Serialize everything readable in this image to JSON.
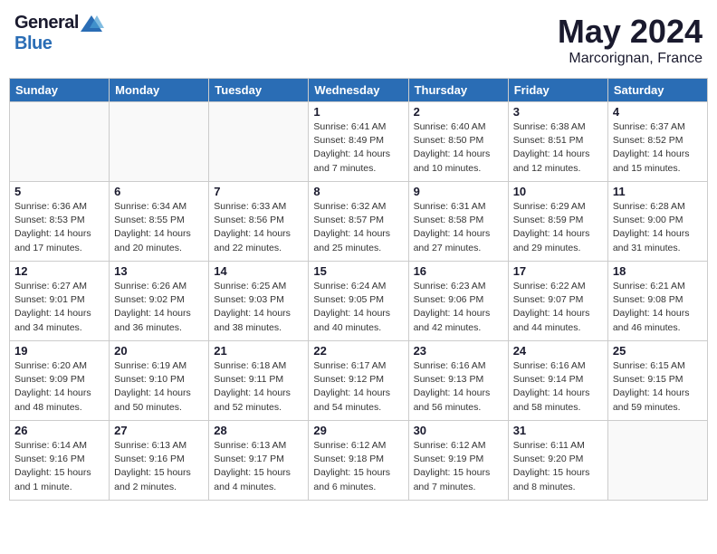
{
  "header": {
    "logo_general": "General",
    "logo_blue": "Blue",
    "title": "May 2024",
    "location": "Marcorignan, France"
  },
  "weekdays": [
    "Sunday",
    "Monday",
    "Tuesday",
    "Wednesday",
    "Thursday",
    "Friday",
    "Saturday"
  ],
  "weeks": [
    [
      {
        "day": "",
        "info": ""
      },
      {
        "day": "",
        "info": ""
      },
      {
        "day": "",
        "info": ""
      },
      {
        "day": "1",
        "info": "Sunrise: 6:41 AM\nSunset: 8:49 PM\nDaylight: 14 hours\nand 7 minutes."
      },
      {
        "day": "2",
        "info": "Sunrise: 6:40 AM\nSunset: 8:50 PM\nDaylight: 14 hours\nand 10 minutes."
      },
      {
        "day": "3",
        "info": "Sunrise: 6:38 AM\nSunset: 8:51 PM\nDaylight: 14 hours\nand 12 minutes."
      },
      {
        "day": "4",
        "info": "Sunrise: 6:37 AM\nSunset: 8:52 PM\nDaylight: 14 hours\nand 15 minutes."
      }
    ],
    [
      {
        "day": "5",
        "info": "Sunrise: 6:36 AM\nSunset: 8:53 PM\nDaylight: 14 hours\nand 17 minutes."
      },
      {
        "day": "6",
        "info": "Sunrise: 6:34 AM\nSunset: 8:55 PM\nDaylight: 14 hours\nand 20 minutes."
      },
      {
        "day": "7",
        "info": "Sunrise: 6:33 AM\nSunset: 8:56 PM\nDaylight: 14 hours\nand 22 minutes."
      },
      {
        "day": "8",
        "info": "Sunrise: 6:32 AM\nSunset: 8:57 PM\nDaylight: 14 hours\nand 25 minutes."
      },
      {
        "day": "9",
        "info": "Sunrise: 6:31 AM\nSunset: 8:58 PM\nDaylight: 14 hours\nand 27 minutes."
      },
      {
        "day": "10",
        "info": "Sunrise: 6:29 AM\nSunset: 8:59 PM\nDaylight: 14 hours\nand 29 minutes."
      },
      {
        "day": "11",
        "info": "Sunrise: 6:28 AM\nSunset: 9:00 PM\nDaylight: 14 hours\nand 31 minutes."
      }
    ],
    [
      {
        "day": "12",
        "info": "Sunrise: 6:27 AM\nSunset: 9:01 PM\nDaylight: 14 hours\nand 34 minutes."
      },
      {
        "day": "13",
        "info": "Sunrise: 6:26 AM\nSunset: 9:02 PM\nDaylight: 14 hours\nand 36 minutes."
      },
      {
        "day": "14",
        "info": "Sunrise: 6:25 AM\nSunset: 9:03 PM\nDaylight: 14 hours\nand 38 minutes."
      },
      {
        "day": "15",
        "info": "Sunrise: 6:24 AM\nSunset: 9:05 PM\nDaylight: 14 hours\nand 40 minutes."
      },
      {
        "day": "16",
        "info": "Sunrise: 6:23 AM\nSunset: 9:06 PM\nDaylight: 14 hours\nand 42 minutes."
      },
      {
        "day": "17",
        "info": "Sunrise: 6:22 AM\nSunset: 9:07 PM\nDaylight: 14 hours\nand 44 minutes."
      },
      {
        "day": "18",
        "info": "Sunrise: 6:21 AM\nSunset: 9:08 PM\nDaylight: 14 hours\nand 46 minutes."
      }
    ],
    [
      {
        "day": "19",
        "info": "Sunrise: 6:20 AM\nSunset: 9:09 PM\nDaylight: 14 hours\nand 48 minutes."
      },
      {
        "day": "20",
        "info": "Sunrise: 6:19 AM\nSunset: 9:10 PM\nDaylight: 14 hours\nand 50 minutes."
      },
      {
        "day": "21",
        "info": "Sunrise: 6:18 AM\nSunset: 9:11 PM\nDaylight: 14 hours\nand 52 minutes."
      },
      {
        "day": "22",
        "info": "Sunrise: 6:17 AM\nSunset: 9:12 PM\nDaylight: 14 hours\nand 54 minutes."
      },
      {
        "day": "23",
        "info": "Sunrise: 6:16 AM\nSunset: 9:13 PM\nDaylight: 14 hours\nand 56 minutes."
      },
      {
        "day": "24",
        "info": "Sunrise: 6:16 AM\nSunset: 9:14 PM\nDaylight: 14 hours\nand 58 minutes."
      },
      {
        "day": "25",
        "info": "Sunrise: 6:15 AM\nSunset: 9:15 PM\nDaylight: 14 hours\nand 59 minutes."
      }
    ],
    [
      {
        "day": "26",
        "info": "Sunrise: 6:14 AM\nSunset: 9:16 PM\nDaylight: 15 hours\nand 1 minute."
      },
      {
        "day": "27",
        "info": "Sunrise: 6:13 AM\nSunset: 9:16 PM\nDaylight: 15 hours\nand 2 minutes."
      },
      {
        "day": "28",
        "info": "Sunrise: 6:13 AM\nSunset: 9:17 PM\nDaylight: 15 hours\nand 4 minutes."
      },
      {
        "day": "29",
        "info": "Sunrise: 6:12 AM\nSunset: 9:18 PM\nDaylight: 15 hours\nand 6 minutes."
      },
      {
        "day": "30",
        "info": "Sunrise: 6:12 AM\nSunset: 9:19 PM\nDaylight: 15 hours\nand 7 minutes."
      },
      {
        "day": "31",
        "info": "Sunrise: 6:11 AM\nSunset: 9:20 PM\nDaylight: 15 hours\nand 8 minutes."
      },
      {
        "day": "",
        "info": ""
      }
    ]
  ]
}
